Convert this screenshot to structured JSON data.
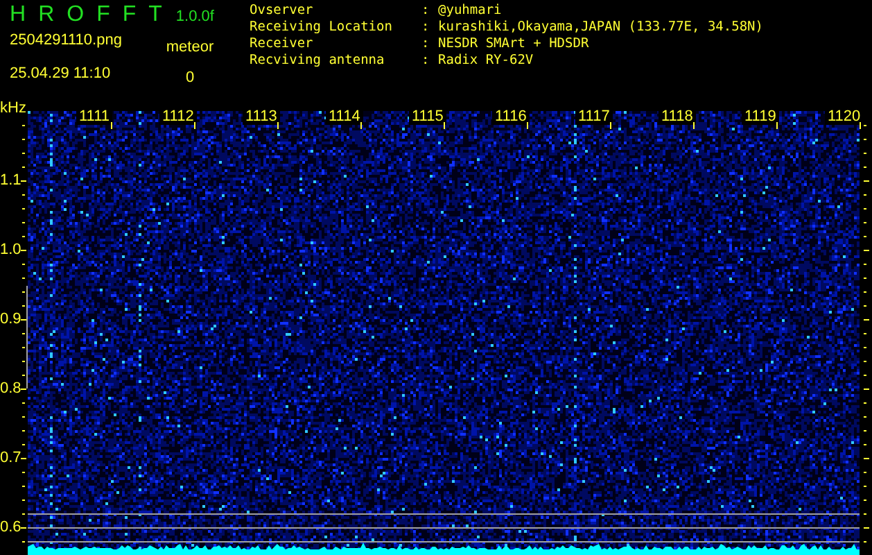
{
  "title_letters": [
    "H",
    "R",
    "O",
    "F",
    "F",
    "T"
  ],
  "version": "1.0.0f",
  "filename": "2504291110.png",
  "datetime": "25.04.29 11:10",
  "counter": {
    "label": "meteor",
    "value": "0"
  },
  "info": [
    {
      "label": "Ovserver",
      "separator": ":",
      "value": "@yuhmari"
    },
    {
      "label": "Receiving Location",
      "separator": ":",
      "value": "kurashiki,Okayama,JAPAN (133.77E, 34.58N)"
    },
    {
      "label": "Receiver",
      "separator": ":",
      "value": "NESDR SMArt + HDSDR"
    },
    {
      "label": "Recviving antenna",
      "separator": ":",
      "value": "Radix RY-62V"
    }
  ],
  "axis_unit": "kHz",
  "x_labels": [
    "1111",
    "1112",
    "1113",
    "1114",
    "1115",
    "1116",
    "1117",
    "1118",
    "1119",
    "1120"
  ],
  "y_labels": [
    "1.1",
    "1.0",
    "0.9",
    "0.8",
    "0.7",
    "0.6"
  ]
}
